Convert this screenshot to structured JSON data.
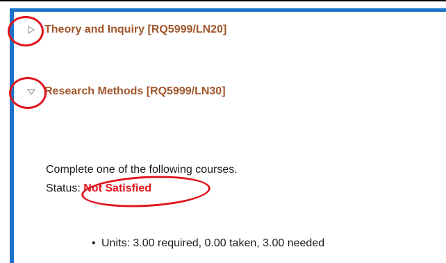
{
  "sections": [
    {
      "id": "theory",
      "label": "Theory and Inquiry [RQ5999/LN20]",
      "state": "collapsed"
    },
    {
      "id": "methods",
      "label": "Research Methods [RQ5999/LN30]",
      "state": "expanded"
    }
  ],
  "requirement": {
    "instruction": "Complete one of the following courses.",
    "status_label": "Status:",
    "status_value": "Not Satisfied",
    "units_line": "Units: 3.00 required, 0.00 taken, 3.00 needed"
  },
  "colors": {
    "accent_blue": "#1a73c9",
    "link_brown": "#a0552a",
    "status_red": "#e0141c",
    "annotation_red": "#e0141c"
  },
  "icons": {
    "collapsed": "triangle-right-icon",
    "expanded": "triangle-down-icon"
  }
}
